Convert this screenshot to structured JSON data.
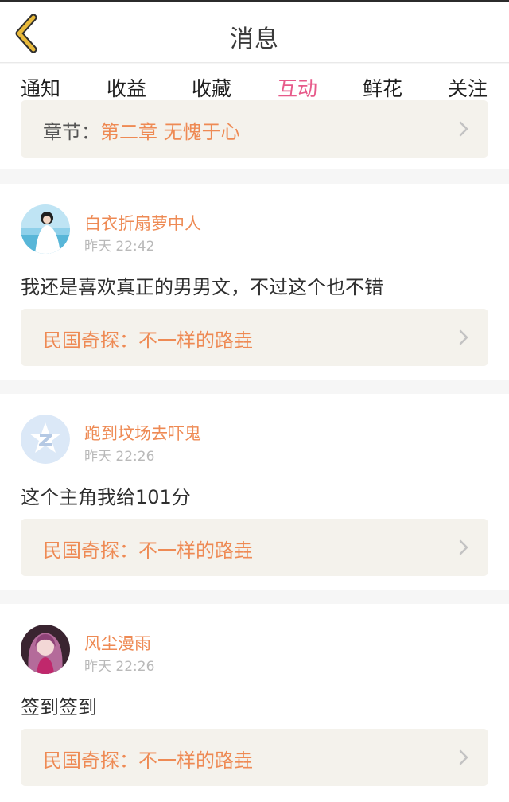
{
  "header": {
    "title": "消息"
  },
  "tabs": [
    {
      "label": "通知"
    },
    {
      "label": "收益"
    },
    {
      "label": "收藏"
    },
    {
      "label": "互动",
      "active": true
    },
    {
      "label": "鲜花"
    },
    {
      "label": "关注"
    }
  ],
  "top_card": {
    "prefix": "章节：",
    "link": "第二章  无愧于心"
  },
  "posts": [
    {
      "user": "白衣折扇萝中人",
      "time": "昨天 22:42",
      "text": "我还是喜欢真正的男男文，不过这个也不错",
      "link": "民国奇探：不一样的路垚"
    },
    {
      "user": "跑到坟场去吓鬼",
      "time": "昨天 22:26",
      "text": "这个主角我给101分",
      "link": "民国奇探：不一样的路垚"
    },
    {
      "user": "风尘漫雨",
      "time": "昨天 22:26",
      "text": "签到签到",
      "link": "民国奇探：不一样的路垚"
    }
  ],
  "colors": {
    "accent": "#e75a8a",
    "link": "#ee8a54",
    "header_icon": "#e8b93a"
  }
}
